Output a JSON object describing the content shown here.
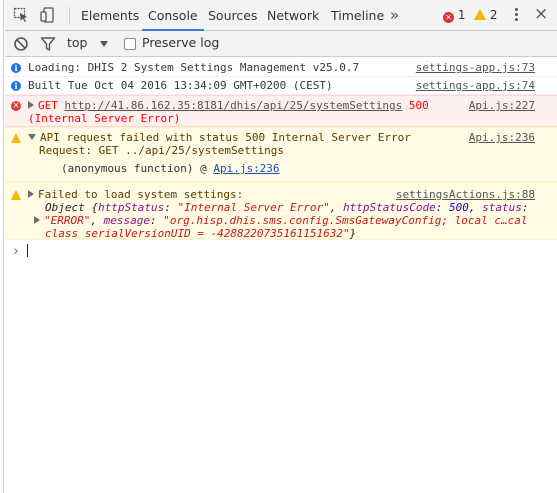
{
  "tabs": [
    "Elements",
    "Console",
    "Sources",
    "Network",
    "Timeline"
  ],
  "active_tab": "Console",
  "more_tabs_glyph": "»",
  "error_count": "1",
  "warning_count": "2",
  "close_glyph": "×",
  "filter": {
    "context": "top",
    "preserve_log_label": "Preserve log"
  },
  "messages": {
    "m1": {
      "text": "Loading: DHIS 2 System Settings Management v25.0.7",
      "source": "settings-app.js:73"
    },
    "m2": {
      "text": "Built Tue Oct 04 2016 13:34:09 GMT+0200 (CEST)",
      "source": "settings-app.js:74"
    },
    "m3": {
      "method": "GET",
      "url": "http://41.86.162.35:8181/dhis/api/25/systemSettings",
      "status": "500",
      "status_text": "(Internal Server Error)",
      "source": "Api.js:227"
    },
    "m4": {
      "text": "API request failed with status 500 Internal Server Error",
      "request": "Request: GET ../api/25/systemSettings",
      "stack_fn": "(anonymous function) @",
      "stack_link": "Api.js:236",
      "source": "Api.js:236"
    },
    "m5": {
      "text": "Failed to load system settings:",
      "source": "settingsActions.js:88",
      "obj_prefix": "Object {",
      "k1": "httpStatus",
      "v1": "\"Internal Server Error\"",
      "k2": "httpStatusCode",
      "v2": "500",
      "k3": "status",
      "v3": "\"ERROR\"",
      "k4": "message",
      "v4": "\"org.hisp.dhis.sms.config.SmsGatewayConfig; local c…cal",
      "v4b": "class serialVersionUID = -4288220735161151632\"",
      "obj_suffix": "}"
    }
  },
  "colors": {
    "accent": "#3879d9",
    "error_bg": "#fff0f0",
    "warning_bg": "#fffbe5",
    "error_text": "#ff0000",
    "info_icon": "#1a73e8"
  }
}
